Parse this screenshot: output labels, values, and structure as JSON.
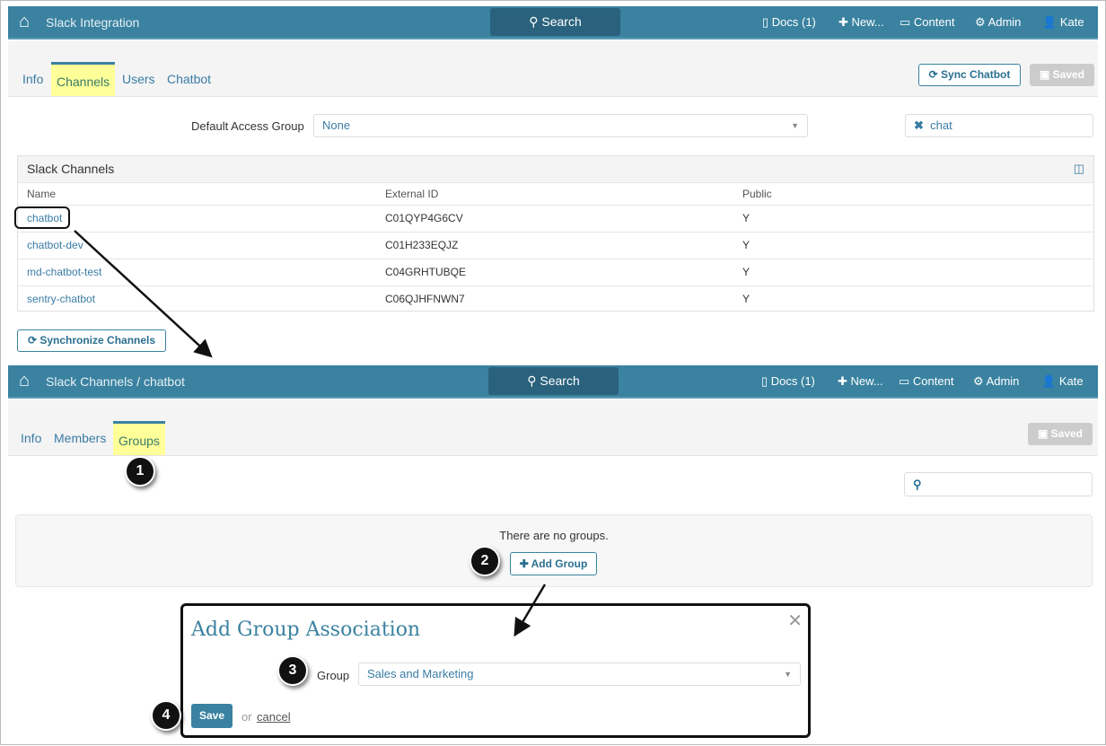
{
  "top": {
    "title": "Slack Integration",
    "search": "Search",
    "docs": "Docs (1)",
    "new": "New...",
    "content": "Content",
    "admin": "Admin",
    "user": "Kate",
    "tabs": [
      "Info",
      "Channels",
      "Users",
      "Chatbot"
    ],
    "sync_chatbot": "Sync Chatbot",
    "saved": "Saved",
    "default_access_label": "Default Access Group",
    "default_access_value": "None",
    "filter_value": "chat",
    "table": {
      "title": "Slack Channels",
      "columns": [
        "Name",
        "External ID",
        "Public"
      ],
      "rows": [
        [
          "chatbot",
          "C01QYP4G6CV",
          "Y"
        ],
        [
          "chatbot-dev",
          "C01H233EQJZ",
          "Y"
        ],
        [
          "md-chatbot-test",
          "C04GRHTUBQE",
          "Y"
        ],
        [
          "sentry-chatbot",
          "C06QJHFNWN7",
          "Y"
        ]
      ]
    },
    "sync_channels": "Synchronize Channels"
  },
  "detail": {
    "title": "Slack Channels / chatbot",
    "search": "Search",
    "docs": "Docs (1)",
    "new": "New...",
    "content": "Content",
    "admin": "Admin",
    "user": "Kate",
    "tabs": [
      "Info",
      "Members",
      "Groups"
    ],
    "saved": "Saved",
    "empty": "There are no groups.",
    "add_group": "Add Group"
  },
  "modal": {
    "title": "Add Group Association",
    "group_label": "Group",
    "group_value": "Sales and Marketing",
    "save": "Save",
    "or": "or",
    "cancel": "cancel"
  },
  "steps": [
    "1",
    "2",
    "3",
    "4"
  ]
}
